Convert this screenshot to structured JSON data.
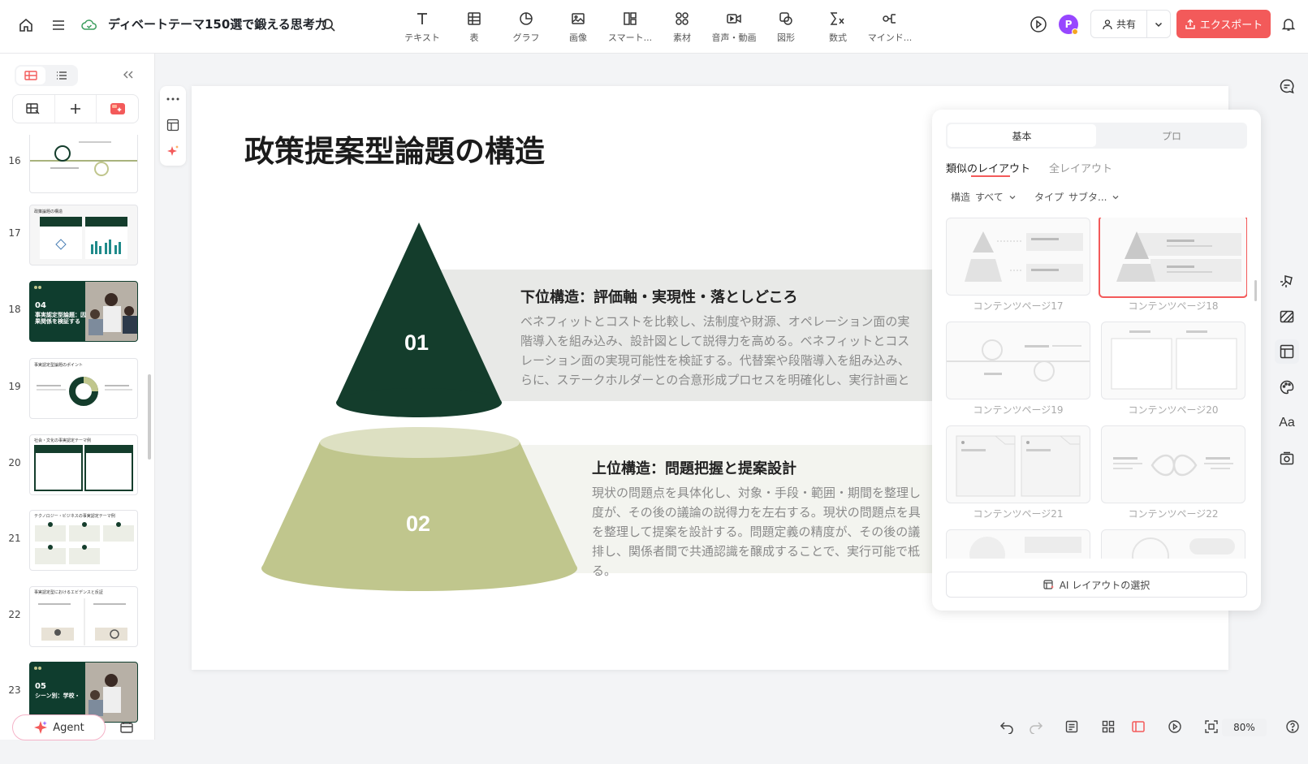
{
  "header": {
    "doc_title": "ディベートテーマ150選で鍛える思考力",
    "tools": [
      {
        "label": "テキスト",
        "icon": "text-icon"
      },
      {
        "label": "表",
        "icon": "table-icon"
      },
      {
        "label": "グラフ",
        "icon": "chart-icon"
      },
      {
        "label": "画像",
        "icon": "image-icon"
      },
      {
        "label": "スマート...",
        "icon": "smart-icon"
      },
      {
        "label": "素材",
        "icon": "assets-icon"
      },
      {
        "label": "音声・動画",
        "icon": "video-icon"
      },
      {
        "label": "図形",
        "icon": "shape-icon"
      },
      {
        "label": "数式",
        "icon": "formula-icon"
      },
      {
        "label": "マインド...",
        "icon": "mindmap-icon"
      }
    ],
    "avatar_initial": "P",
    "share_label": "共有",
    "export_label": "エクスポート",
    "accent_color": "#f35a5a"
  },
  "sidebar": {
    "slides": [
      {
        "num": "16"
      },
      {
        "num": "17",
        "title": "政策論題の構造"
      },
      {
        "num": "18",
        "chapter": "04",
        "title": "事実認定型論題：因果関係を検証する"
      },
      {
        "num": "19",
        "title": "事実認定型論題のポイント"
      },
      {
        "num": "20",
        "title": "社会・文化の事実認定テーマ例"
      },
      {
        "num": "21",
        "title": "テクノロジー・ビジネスの事実認定テーマ例"
      },
      {
        "num": "22",
        "title": "事実認定型におけるエビデンスと反証"
      },
      {
        "num": "23",
        "chapter": "05",
        "title": "シーン別：学校・"
      }
    ],
    "agent_label": "Agent"
  },
  "slide": {
    "title": "政策提案型論題の構造",
    "dark_green": "#143d2c",
    "light_green": "#c0c68d",
    "level1": {
      "number": "01",
      "heading": "下位構造：評価軸・実現性・落としどころ",
      "lines": [
        "ベネフィットとコストを比較し、法制度や財源、オペレーション面の実",
        "階導入を組み込み、設計図として説得力を高める。ベネフィットとコス",
        "レーション面の実現可能性を検証する。代替案や段階導入を組み込み、",
        "らに、ステークホルダーとの合意形成プロセスを明確化し、実行計画と"
      ]
    },
    "level2": {
      "number": "02",
      "heading": "上位構造：問題把握と提案設計",
      "lines": [
        "現状の問題点を具体化し、対象・手段・範囲・期間を整理し",
        "度が、その後の議論の説得力を左右する。現状の問題点を具",
        "を整理して提案を設計する。問題定義の精度が、その後の議",
        "排し、関係者間で共通認識を醸成することで、実行可能で柢",
        "る。"
      ]
    }
  },
  "layout_panel": {
    "tabs": [
      "基本",
      "プロ"
    ],
    "active_tab": "基本",
    "subtabs": [
      "類似のレイアウト",
      "全レイアウト"
    ],
    "filters": [
      {
        "label": "構造",
        "value": "すべて"
      },
      {
        "label": "タイプ",
        "value": "サブタ..."
      }
    ],
    "layouts": [
      {
        "label": "コンテンツページ17"
      },
      {
        "label": "コンテンツページ18",
        "selected": true
      },
      {
        "label": "コンテンツページ19"
      },
      {
        "label": "コンテンツページ20"
      },
      {
        "label": "コンテンツページ21"
      },
      {
        "label": "コンテンツページ22"
      }
    ],
    "ai_button": "AI レイアウトの選択"
  },
  "statusbar": {
    "zoom": "80%"
  }
}
